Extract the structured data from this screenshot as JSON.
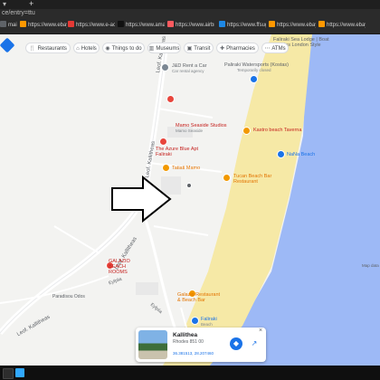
{
  "browser": {
    "url_fragment": "ce/entry=ttu",
    "new_tab_label": "+",
    "tab_menu_label": "▾",
    "bookmarks": [
      {
        "label": "mai",
        "color": "#5f6368"
      },
      {
        "label": "https://www.ebay.co...",
        "color": "#ff9800"
      },
      {
        "label": "https://www.e-activ...",
        "color": "#e53935"
      },
      {
        "label": "https://www.amazo...",
        "color": "#111111"
      },
      {
        "label": "https://www.airbnb...",
        "color": "#ff5a5f"
      },
      {
        "label": "https://www.ffsugo...",
        "color": "#1e88e5"
      },
      {
        "label": "https://www.ebay.co...",
        "color": "#ff9800"
      },
      {
        "label": "https://www.ebay.co...",
        "color": "#ff9800"
      }
    ]
  },
  "filters": [
    {
      "label": "Restaurants",
      "icon": "fork-knife-icon",
      "glyph": "🍴"
    },
    {
      "label": "Hotels",
      "icon": "bed-icon",
      "glyph": "⌂"
    },
    {
      "label": "Things to do",
      "icon": "camera-icon",
      "glyph": "◉"
    },
    {
      "label": "Museums",
      "icon": "museum-icon",
      "glyph": "▥"
    },
    {
      "label": "Transit",
      "icon": "bus-icon",
      "glyph": "▣"
    },
    {
      "label": "Pharmacies",
      "icon": "pharmacy-icon",
      "glyph": "✚"
    },
    {
      "label": "ATMs",
      "icon": "atm-icon",
      "glyph": "⋯"
    }
  ],
  "map": {
    "streets": [
      "Leof. Kallitheas",
      "Leof. Kallitheas",
      "Leof. Kallitheas",
      "Leof. Kallitheas",
      "Paradisou Odos",
      "Eyfplia",
      "Eyfplia"
    ],
    "pois": [
      {
        "name": "Faliraki Sea Lodge | Boat Rhodes London Style",
        "color": "#5f6368"
      },
      {
        "name": "J&D Rent a Car",
        "sub": "Car rental agency",
        "color": "#5f6368"
      },
      {
        "name": "Paliraki Watersports (Kostas)",
        "sub": "Temporarily closed",
        "color": "#5f6368"
      },
      {
        "name": "Mamo Seaside Studios",
        "sub": "Mamo Seaside",
        "color": "#c5221f"
      },
      {
        "name": "Kastro beach Taverna",
        "color": "#c5221f"
      },
      {
        "name": "The Azure Blue Apt Faliraki",
        "color": "#c5221f"
      },
      {
        "name": "Tatiati Mamo",
        "color": "#e37400"
      },
      {
        "name": "NaNa Beach",
        "color": "#1a73e8"
      },
      {
        "name": "Tucan Beach Bar Restaurant",
        "color": "#e37400"
      },
      {
        "name": "GALAZIO BEACH ROOMS",
        "color": "#c5221f"
      },
      {
        "name": "Galazio Restaurant & Beach Bar",
        "color": "#e37400"
      },
      {
        "name": "Faliraki",
        "sub": "Beach",
        "color": "#1a73e8"
      }
    ],
    "scale_text": "Map data"
  },
  "place_card": {
    "title": "Kallithea",
    "subtitle": "Rhodes 851 00",
    "coords": "36.381513, 28.207460",
    "directions_icon": "directions-icon",
    "share_icon": "share-icon",
    "close_label": "×"
  },
  "taskbar": {
    "apps": [
      {
        "name": "start-button",
        "color": "#2d2d2d"
      },
      {
        "name": "photoshop-app",
        "color": "#31a8ff"
      }
    ]
  }
}
